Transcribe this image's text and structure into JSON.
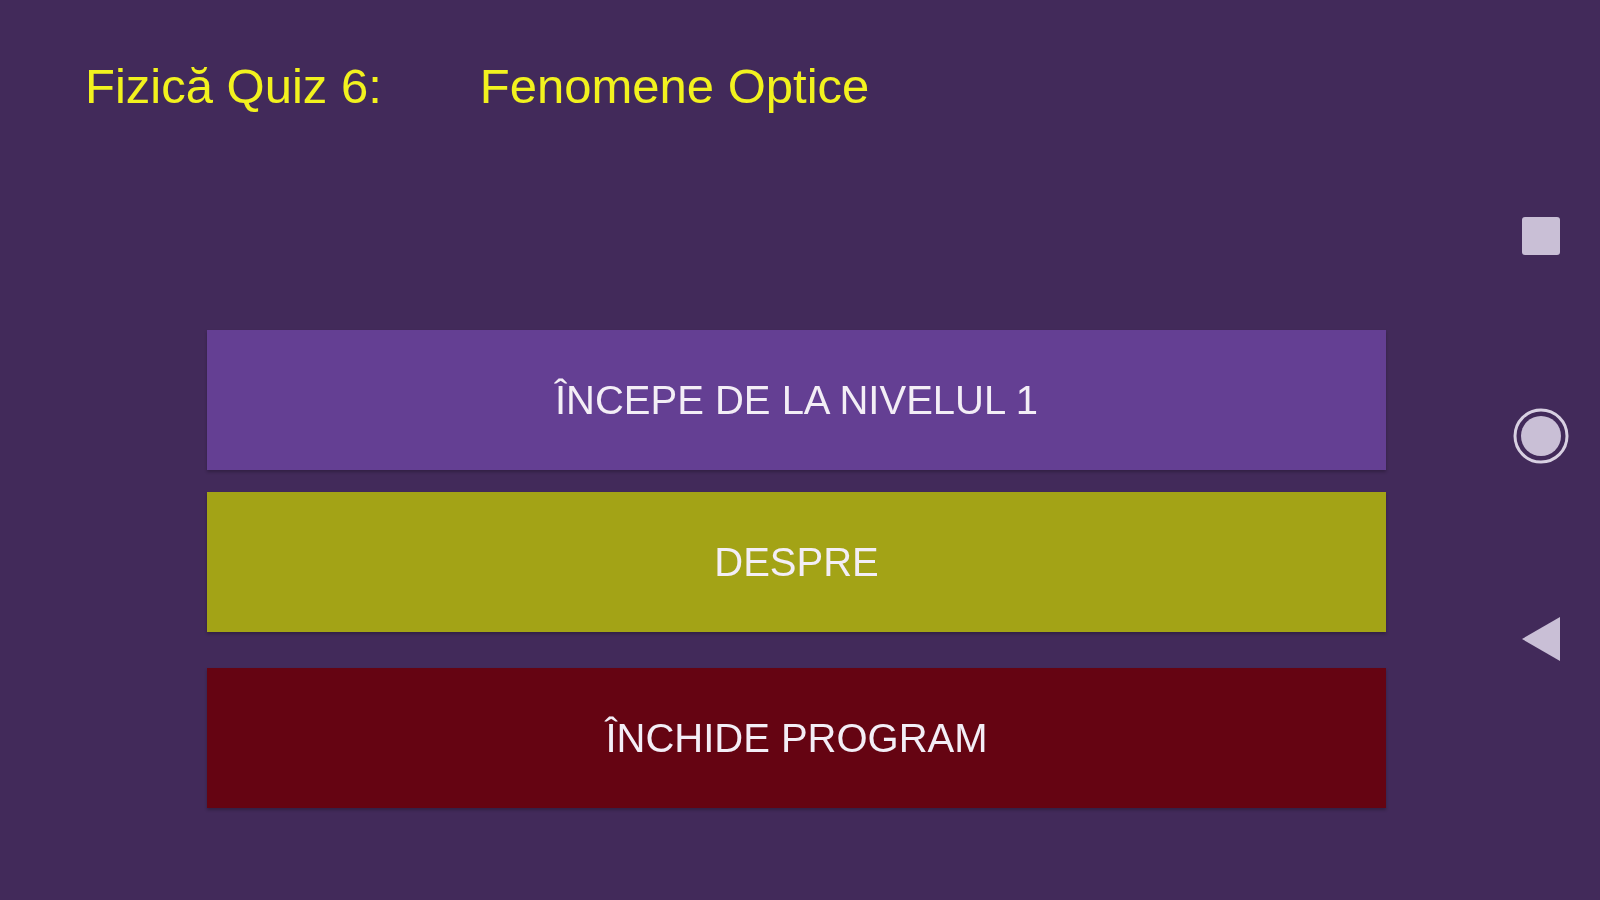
{
  "title": {
    "prefix": "Fizică Quiz 6:",
    "subject": "Fenomene Optice"
  },
  "buttons": [
    {
      "label": "ÎNCEPE DE LA NIVELUL 1",
      "color": "#643f93"
    },
    {
      "label": "DESPRE",
      "color": "#a3a316"
    },
    {
      "label": "ÎNCHIDE PROGRAM",
      "color": "#650412"
    }
  ]
}
